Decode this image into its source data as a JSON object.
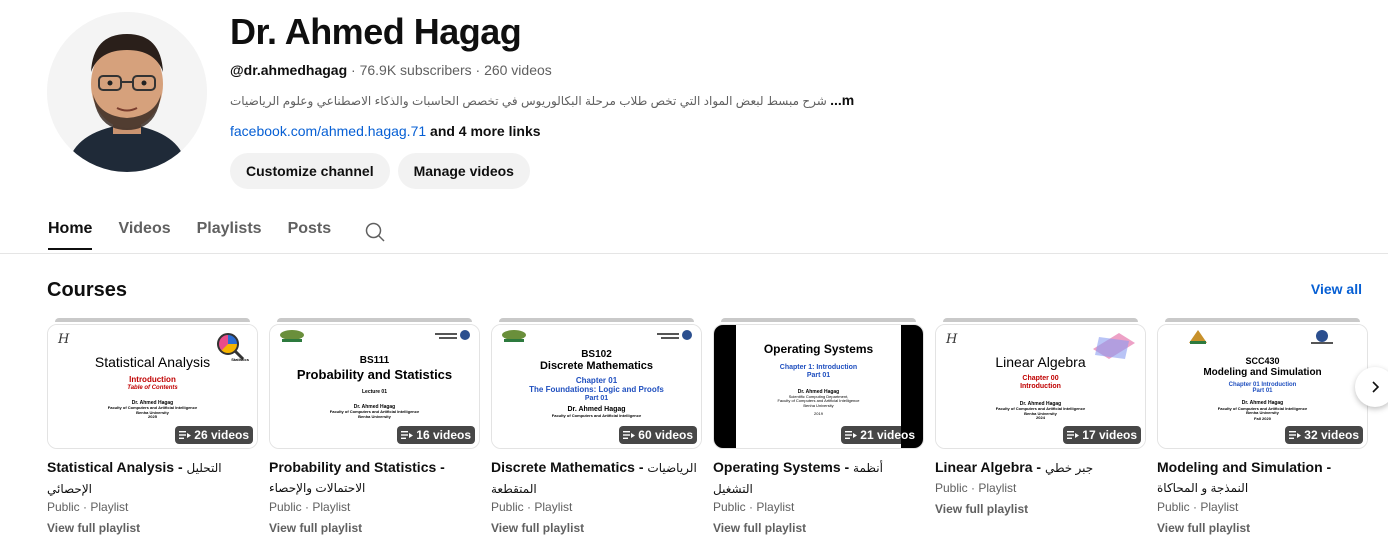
{
  "channel": {
    "name": "Dr. Ahmed Hagag",
    "handle": "@dr.ahmedhagag",
    "stats": " · 76.9K subscribers · 260 videos",
    "description": "شرح مبسط لبعض المواد التي تخص طلاب مرحلة البكالوريوس في تخصص الحاسبات والذكاء الاصطناعي وعلوم الرياضيات",
    "more_label": "...more",
    "link": "facebook.com/ahmed.hagag.71",
    "more_links": " and 4 more links"
  },
  "actions": {
    "customize": "Customize channel",
    "manage": "Manage videos"
  },
  "tabs": [
    "Home",
    "Videos",
    "Playlists",
    "Posts"
  ],
  "shelf": {
    "title": "Courses",
    "view_all": "View all"
  },
  "playlists": [
    {
      "title_en": "Statistical Analysis - ",
      "title_ar": "التحليل الإحصائي",
      "count": "26 videos",
      "visibility": "Public · Playlist",
      "link": "View full playlist",
      "thumb": {
        "heading": "Statistical Analysis",
        "sub1": "Introduction",
        "sub2": "Table of Contents",
        "author": "Dr. Ahmed Hagag",
        "org": "Faculty of Computers and Artificial Intelligence",
        "uni": "Benha University",
        "year": "2025",
        "side": "Statistics"
      }
    },
    {
      "title_en": "Probability and Statistics - ",
      "title_ar": "الاحتمالات والإحصاء",
      "count": "16 videos",
      "visibility": "Public · Playlist",
      "link": "View full playlist",
      "thumb": {
        "code": "BS111",
        "heading": "Probability and Statistics",
        "sub1": "Lecture 01",
        "author": "Dr. Ahmed Hagag",
        "org": "Faculty of Computers and Artificial Intelligence",
        "uni": "Benha University"
      }
    },
    {
      "title_en": "Discrete Mathematics - ",
      "title_ar": "الرياضيات المتقطعة",
      "count": "60 videos",
      "visibility": "Public · Playlist",
      "link": "View full playlist",
      "thumb": {
        "code": "BS102",
        "heading": "Discrete Mathematics",
        "sub1": "Chapter 01",
        "sub2": "The Foundations: Logic and Proofs",
        "sub3": "Part 01",
        "author": "Dr. Ahmed Hagag",
        "org": "Faculty of Computers and Artificial Intelligence"
      }
    },
    {
      "title_en": "Operating Systems - ",
      "title_ar": "أنظمة التشغيل",
      "count": "21 videos",
      "visibility": "Public · Playlist",
      "link": "View full playlist",
      "thumb": {
        "heading": "Operating Systems",
        "sub1": "Chapter 1: Introduction",
        "sub2": "Part 01",
        "author": "Dr. Ahmed Hagag",
        "org": "Scientific Computing Department,",
        "org2": "Faculty of Computers and Artificial Intelligence",
        "uni": "Benha University",
        "year": "2019"
      }
    },
    {
      "title_en": "Linear Algebra - ",
      "title_ar": "جبر خطي",
      "count": "17 videos",
      "visibility": "Public · Playlist",
      "link": "View full playlist",
      "thumb": {
        "heading": "Linear Algebra",
        "sub1": "Chapter 00",
        "sub2": "Introduction",
        "author": "Dr. Ahmed Hagag",
        "org": "Faculty of Computers and Artificial Intelligence",
        "uni": "Benha University",
        "year": "2024"
      }
    },
    {
      "title_en": "Modeling and Simulation - ",
      "title_ar": "النمذجة و المحاكاة",
      "count": "32 videos",
      "visibility": "Public · Playlist",
      "link": "View full playlist",
      "thumb": {
        "code": "SCC430",
        "heading": "Modeling and Simulation",
        "sub1": "Chapter 01 Introduction",
        "sub2": "Part 01",
        "author": "Dr. Ahmed Hagag",
        "org": "Faculty of Computers and Artificial Intelligence",
        "uni": "Benha University",
        "year": "Fall 2020"
      }
    }
  ],
  "colors": {
    "link": "#065fd4",
    "heading_red": "#c00000",
    "heading_blue": "#1f4fbf"
  }
}
